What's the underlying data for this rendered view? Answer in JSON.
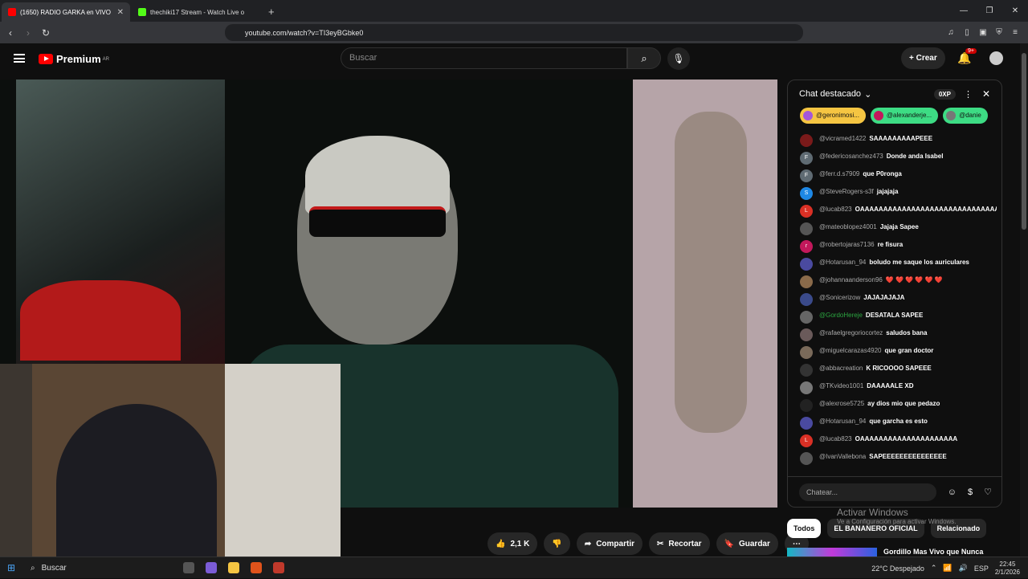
{
  "browser": {
    "tabs": [
      {
        "title": "(1650) RADIO GARKA en VIVO",
        "active": true,
        "close": "✕"
      },
      {
        "title": "thechiki17 Stream - Watch Live o",
        "active": false
      }
    ],
    "new_tab": "+",
    "url": "youtube.com/watch?v=TI3eyBGbke0",
    "window_controls": [
      "—",
      "❐",
      "✕"
    ]
  },
  "youtube": {
    "logo_text": "Premium",
    "logo_region": "AR",
    "search_placeholder": "Buscar",
    "create_label": "Crear",
    "notif_badge": "9+"
  },
  "chat": {
    "title": "Chat destacado",
    "points": "0XP",
    "pinned": [
      {
        "name": "@geronimosi...",
        "color": "#f5c542"
      },
      {
        "name": "@alexanderje...",
        "color": "#3ddc84"
      },
      {
        "name": "@danie",
        "color": "#3ddc84"
      }
    ],
    "messages": [
      {
        "user": "@vicramed1422",
        "text": "SAAAAAAAAAPEEE",
        "av": "",
        "color": "#7a1a1a"
      },
      {
        "user": "@federicosanchez473",
        "text": "Donde anda Isabel",
        "av": "F",
        "color": "#5f6b73"
      },
      {
        "user": "@ferr.d.s7909",
        "text": "que P0ronga",
        "av": "F",
        "color": "#5f6b73"
      },
      {
        "user": "@SteveRogers-s3f",
        "text": "jajajaja",
        "av": "S",
        "color": "#1e88e5"
      },
      {
        "user": "@lucab823",
        "text": "OAAAAAAAAAAAAAAAAAAAAAAAAAAAAAA",
        "av": "L",
        "color": "#d93025"
      },
      {
        "user": "@mateoblopez4001",
        "text": "Jajaja Sapee",
        "av": "",
        "color": "#555"
      },
      {
        "user": "@robertojaras7136",
        "text": "re fisura",
        "av": "r",
        "color": "#c2185b"
      },
      {
        "user": "@Hotarusan_94",
        "text": "boludo me saque los auriculares",
        "av": "",
        "color": "#4a4aa0"
      },
      {
        "user": "@johannaanderson96",
        "text": "❤️ ❤️ ❤️ ❤️ ❤️ ❤️",
        "av": "",
        "color": "#8a6a4a"
      },
      {
        "user": "@Sonicerizow",
        "text": "JAJAJAJAJA",
        "av": "",
        "color": "#3a4a8a"
      },
      {
        "user": "@GordoHereje",
        "text": "DESATALA SAPEE",
        "av": "",
        "color": "#666",
        "mod": true
      },
      {
        "user": "@rafaelgregoriocortez",
        "text": "saludos bana",
        "av": "",
        "color": "#6a5a5a"
      },
      {
        "user": "@miguelcarazas4920",
        "text": "que gran doctor",
        "av": "",
        "color": "#7a6a5a"
      },
      {
        "user": "@abbacreation",
        "text": "K RICOOOO SAPEEE",
        "av": "",
        "color": "#333"
      },
      {
        "user": "@TKvideo1001",
        "text": "DAAAAALE XD",
        "av": "",
        "color": "#777"
      },
      {
        "user": "@alexrose5725",
        "text": "ay dios mio que pedazo",
        "av": "",
        "color": "#222"
      },
      {
        "user": "@Hotarusan_94",
        "text": "que garcha es esto",
        "av": "",
        "color": "#4a4aa0"
      },
      {
        "user": "@lucab823",
        "text": "OAAAAAAAAAAAAAAAAAAAAA",
        "av": "L",
        "color": "#d93025"
      },
      {
        "user": "@IvanVallebona",
        "text": "SAPEEEEEEEEEEEEEEE",
        "av": "",
        "color": "#555"
      }
    ],
    "input_placeholder": "Chatear..."
  },
  "actions": {
    "likes": "2,1 K",
    "share": "Compartir",
    "clip": "Recortar",
    "save": "Guardar",
    "more": "⋯"
  },
  "chips": [
    "Todos",
    "EL BANANERO OFICIAL",
    "Relacionado"
  ],
  "activate_windows": {
    "title": "Activar Windows",
    "sub": "Ve a Configuración para activar Windows."
  },
  "recommendation": {
    "title": "Gordillo Mas Vivo que Nunca"
  },
  "taskbar": {
    "search": "Buscar",
    "weather": "22°C  Despejado",
    "lang": "ESP",
    "time": "22:45",
    "date": "2/1/2026"
  }
}
